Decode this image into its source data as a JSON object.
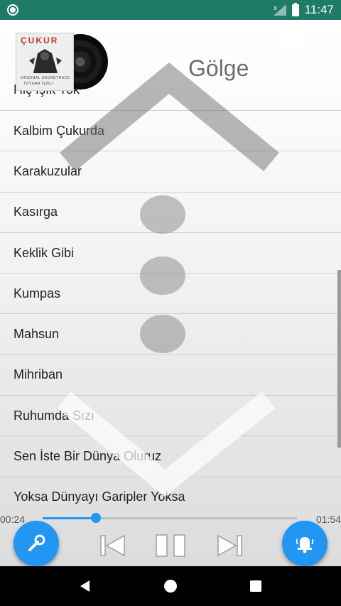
{
  "status_bar": {
    "time": "11:47"
  },
  "album": {
    "title": "ÇUKUR",
    "subtitle_line1": "ORIGINAL SOUNDTRACK",
    "subtitle_line2": "TOYGAR IŞIKLI"
  },
  "now_playing": {
    "title": "Gölge"
  },
  "songs": [
    "Hiç Işık Yok",
    "Kalbim Çukurda",
    "Karakuzular",
    "Kasırga",
    "Keklik Gibi",
    "Kumpas",
    "Mahsun",
    "Mihriban",
    "Ruhumda Sızı",
    "Sen İste Bir Dünya Oluruz",
    "Yoksa Dünyayı Garipler Yoksa"
  ],
  "player": {
    "current_time": "00:24",
    "total_time": "01:54",
    "progress": 0.21
  },
  "colors": {
    "accent": "#2196f3",
    "status_bar": "#1f7a66"
  },
  "icons": {
    "left_fab": "wrench-icon",
    "right_fab": "bell-icon",
    "volume": "speaker-icon",
    "prev": "skip-previous-icon",
    "pause": "pause-icon",
    "next": "skip-next-icon"
  }
}
